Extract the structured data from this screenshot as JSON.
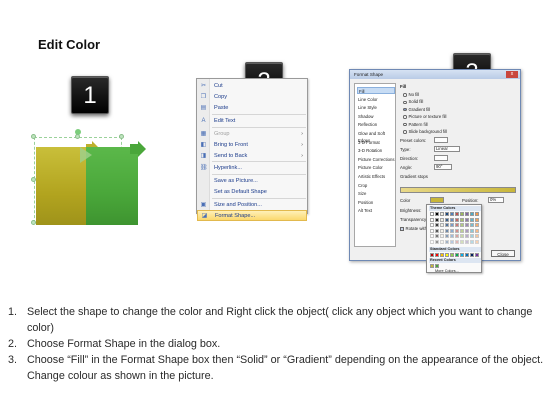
{
  "title": "Edit Color",
  "steps": {
    "one": "1",
    "two": "2",
    "three": "3"
  },
  "context_menu": {
    "items": [
      {
        "label": "Cut",
        "icon": "scissors-icon",
        "glyph": "✂",
        "enabled": true,
        "submenu": false
      },
      {
        "label": "Copy",
        "icon": "copy-icon",
        "glyph": "❐",
        "enabled": true,
        "submenu": false
      },
      {
        "label": "Paste",
        "icon": "paste-icon",
        "glyph": "▤",
        "enabled": true,
        "submenu": false
      },
      {
        "label": "Edit Text",
        "icon": "edit-text-icon",
        "glyph": "A",
        "enabled": true,
        "submenu": false
      },
      {
        "label": "Group",
        "icon": "group-icon",
        "glyph": "▦",
        "enabled": false,
        "submenu": true
      },
      {
        "label": "Bring to Front",
        "icon": "bring-front-icon",
        "glyph": "◧",
        "enabled": true,
        "submenu": true
      },
      {
        "label": "Send to Back",
        "icon": "send-back-icon",
        "glyph": "◨",
        "enabled": true,
        "submenu": true
      },
      {
        "label": "Hyperlink...",
        "icon": "hyperlink-icon",
        "glyph": "⛓",
        "enabled": true,
        "submenu": false
      },
      {
        "label": "Save as Picture...",
        "icon": "",
        "glyph": "",
        "enabled": true,
        "submenu": false
      },
      {
        "label": "Set as Default Shape",
        "icon": "",
        "glyph": "",
        "enabled": true,
        "submenu": false
      },
      {
        "label": "Size and Position...",
        "icon": "size-position-icon",
        "glyph": "▣",
        "enabled": true,
        "submenu": false
      },
      {
        "label": "Format Shape...",
        "icon": "format-shape-icon",
        "glyph": "◪",
        "enabled": true,
        "submenu": false,
        "highlighted": true
      }
    ]
  },
  "format_dialog": {
    "title": "Format Shape",
    "close": "x",
    "categories": [
      "Fill",
      "Line Color",
      "Line Style",
      "Shadow",
      "Reflection",
      "Glow and Soft Edges",
      "3-D Format",
      "3-D Rotation",
      "Picture Corrections",
      "Picture Color",
      "Artistic Effects",
      "Crop",
      "Size",
      "Position",
      "Alt Text"
    ],
    "fill_label": "Fill",
    "fill_options": [
      "No fill",
      "Solid fill",
      "Gradient fill",
      "Picture or texture fill",
      "Pattern fill",
      "Slide background fill"
    ],
    "preset_colors": "Preset colors:",
    "type": "Type:",
    "type_value": "Linear",
    "direction": "Direction:",
    "angle": "Angle:",
    "angle_value": "90°",
    "gradient_stops": "Gradient stops",
    "color": "Color",
    "position": "Position:",
    "position_value": "0%",
    "brightness": "Brightness:",
    "transparency": "Transparency:",
    "rotate": "Rotate with shape",
    "theme_colors": "Theme Colors",
    "standard_colors": "Standard Colors",
    "recent_colors": "Recent Colors",
    "more_colors": "More Colors...",
    "close_button": "Close",
    "accent_color": "#c8b63a"
  },
  "instructions": [
    {
      "num": "1.",
      "text": "Select the shape to change the color and Right click the object( click any object which you want to change color)"
    },
    {
      "num": "2.",
      "text": "Choose Format Shape in the dialog box."
    },
    {
      "num": "3.",
      "text": "Choose “Fill” in the Format Shape box then “Solid” or “Gradient” depending on the appearance of the object. Change colour as shown in the picture."
    }
  ],
  "colors": {
    "yellow_shape": "#b2a41f",
    "green_shape": "#4aa73a",
    "badge": "#000000"
  }
}
